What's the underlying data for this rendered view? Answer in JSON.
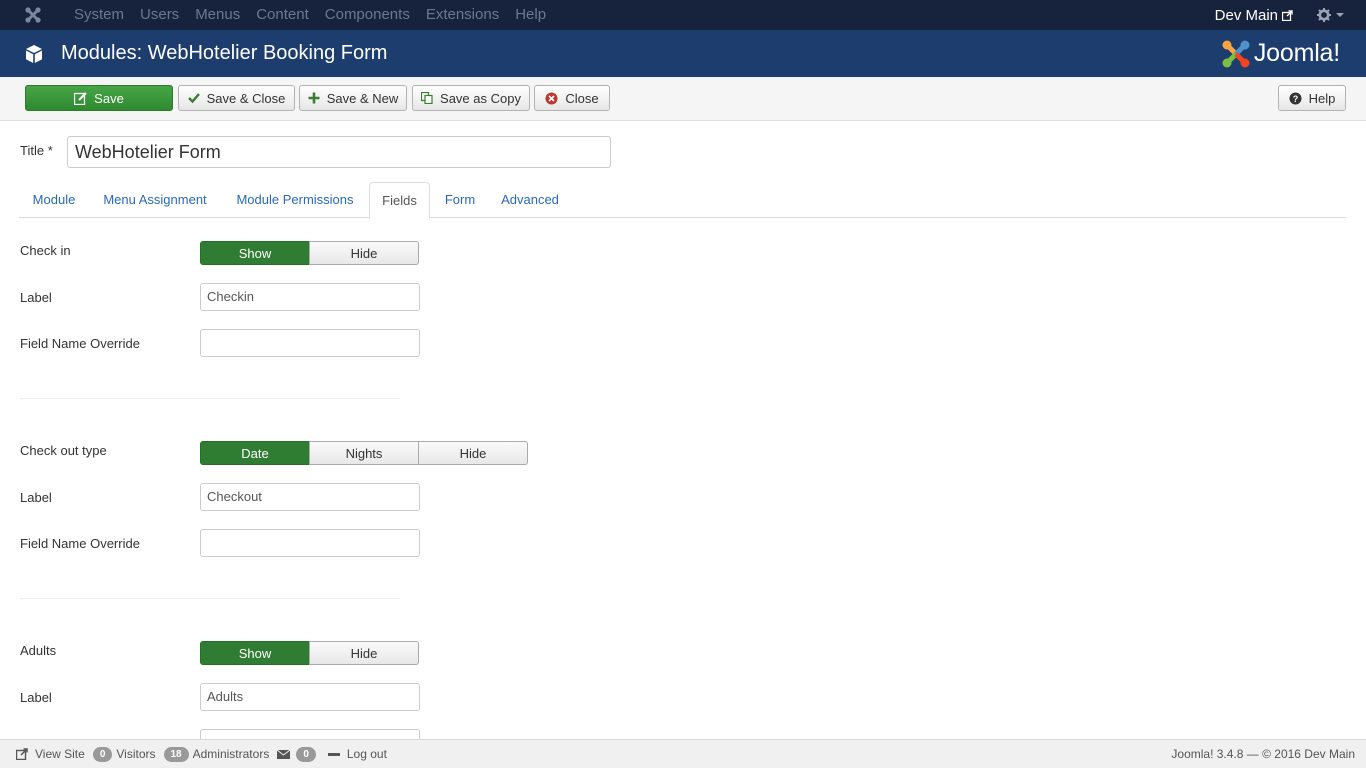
{
  "navbar": {
    "menu": [
      "System",
      "Users",
      "Menus",
      "Content",
      "Components",
      "Extensions",
      "Help"
    ],
    "user": "Dev Main"
  },
  "header": {
    "title": "Modules: WebHotelier Booking Form",
    "brand": "Joomla!"
  },
  "toolbar": {
    "save": "Save",
    "save_close": "Save & Close",
    "save_new": "Save & New",
    "save_copy": "Save as Copy",
    "close": "Close",
    "help": "Help"
  },
  "form": {
    "title_label": "Title *",
    "title_value": "WebHotelier Form"
  },
  "tabs": [
    "Module",
    "Menu Assignment",
    "Module Permissions",
    "Fields",
    "Form",
    "Advanced"
  ],
  "fields": {
    "checkin": {
      "label": "Check in",
      "options": [
        "Show",
        "Hide"
      ],
      "selected": "Show",
      "label_label": "Label",
      "label_value": "Checkin",
      "override_label": "Field Name Override",
      "override_value": ""
    },
    "checkout": {
      "label": "Check out type",
      "options": [
        "Date",
        "Nights",
        "Hide"
      ],
      "selected": "Date",
      "label_label": "Label",
      "label_value": "Checkout",
      "override_label": "Field Name Override",
      "override_value": ""
    },
    "adults": {
      "label": "Adults",
      "options": [
        "Show",
        "Hide"
      ],
      "selected": "Show",
      "label_label": "Label",
      "label_value": "Adults"
    }
  },
  "statusbar": {
    "view_site": "View Site",
    "visitors_count": "0",
    "visitors": "Visitors",
    "admins_count": "18",
    "admins": "Administrators",
    "messages_count": "0",
    "logout": "Log out",
    "version": "Joomla! 3.4.8 — © 2016 Dev Main"
  },
  "colors": {
    "navbar": "#17233d",
    "header": "#1c3d6d",
    "save_button": "#47a447",
    "toggle_on": "#2f7d32",
    "link": "#2a69b8"
  }
}
